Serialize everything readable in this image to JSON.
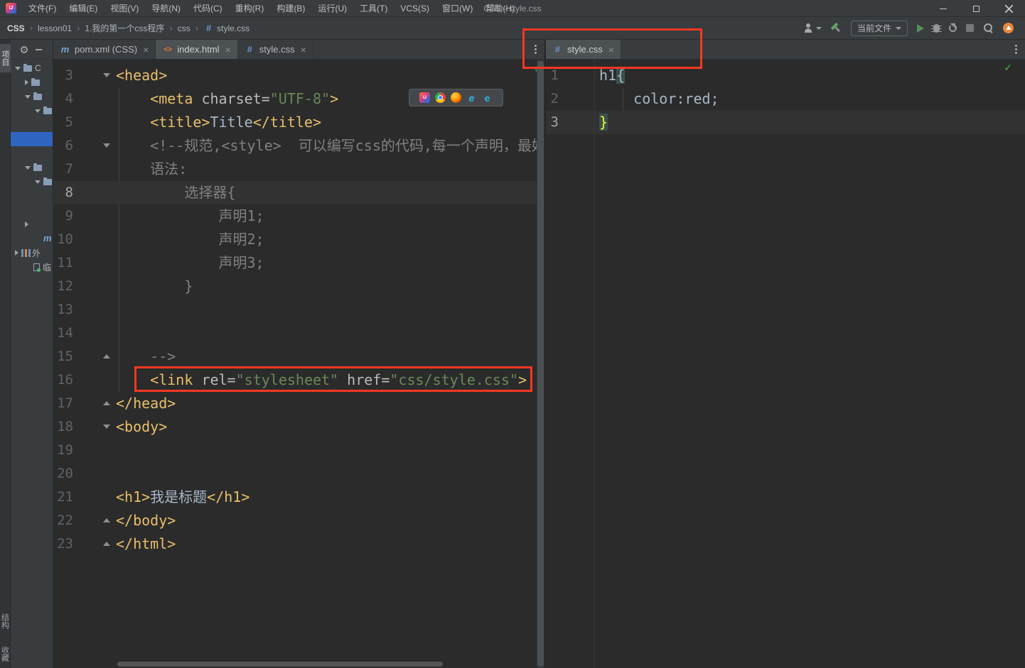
{
  "window": {
    "title": "CSS - style.css",
    "controls": [
      {
        "name": "minimize"
      },
      {
        "name": "maximize"
      },
      {
        "name": "close"
      }
    ]
  },
  "menubar": [
    "文件(F)",
    "编辑(E)",
    "视图(V)",
    "导航(N)",
    "代码(C)",
    "重构(R)",
    "构建(B)",
    "运行(U)",
    "工具(T)",
    "VCS(S)",
    "窗口(W)",
    "帮助(H)"
  ],
  "toolbar": {
    "breadcrumbs": [
      "CSS",
      "lesson01",
      "1.我的第一个css程序",
      "css",
      "style.css"
    ],
    "right": {
      "run_config": "当前文件"
    }
  },
  "stripe": {
    "top": [
      "项目"
    ],
    "bottom": [
      "结构",
      "收藏"
    ]
  },
  "project_tree": {
    "rows": [
      {
        "indent": 0,
        "chevron": "down",
        "icon": "folder",
        "label": "C",
        "selected": false
      },
      {
        "indent": 1,
        "chevron": "right",
        "icon": "folder",
        "label": "",
        "selected": false
      },
      {
        "indent": 1,
        "chevron": "down",
        "icon": "folder",
        "label": "",
        "selected": false
      },
      {
        "indent": 2,
        "chevron": "down",
        "icon": "folder",
        "label": "",
        "selected": false
      },
      {
        "indent": 3,
        "chevron": "none",
        "icon": "none",
        "label": "",
        "selected": false
      },
      {
        "indent": 3,
        "chevron": "none",
        "icon": "none",
        "label": "",
        "selected": true
      },
      {
        "indent": 3,
        "chevron": "none",
        "icon": "none",
        "label": "",
        "selected": false
      },
      {
        "indent": 1,
        "chevron": "down",
        "icon": "folder",
        "label": "",
        "selected": false
      },
      {
        "indent": 2,
        "chevron": "down",
        "icon": "folder",
        "label": "",
        "selected": false
      },
      {
        "indent": 3,
        "chevron": "none",
        "icon": "none",
        "label": "",
        "selected": false
      },
      {
        "indent": 3,
        "chevron": "none",
        "icon": "none",
        "label": "",
        "selected": false
      },
      {
        "indent": 1,
        "chevron": "right",
        "icon": "none",
        "label": "",
        "selected": false
      },
      {
        "indent": 2,
        "chevron": "none",
        "icon": "maven",
        "label": "",
        "selected": false
      },
      {
        "indent": 0,
        "chevron": "right",
        "icon": "libraries",
        "label": "外",
        "selected": false
      },
      {
        "indent": 1,
        "chevron": "none",
        "icon": "scratches",
        "label": "临",
        "selected": false
      }
    ]
  },
  "editors": {
    "left": {
      "tabs": [
        {
          "label": "pom.xml (CSS)",
          "icon": "maven",
          "selected": false,
          "close": "×"
        },
        {
          "label": "index.html",
          "icon": "html",
          "selected": true,
          "close": "×"
        },
        {
          "label": "style.css",
          "icon": "css",
          "selected": false,
          "close": "×"
        }
      ],
      "status_check": "✓",
      "lines": [
        {
          "n": 3,
          "fold": "down",
          "t": [
            [
              "g",
              "<head>"
            ]
          ]
        },
        {
          "n": 4,
          "t": [
            [
              "pl",
              "    "
            ],
            [
              "g",
              "<meta"
            ],
            [
              "pl",
              " "
            ],
            [
              "a",
              "charset="
            ],
            [
              "s",
              "\"UTF-8\""
            ],
            [
              "g",
              ">"
            ]
          ]
        },
        {
          "n": 5,
          "t": [
            [
              "pl",
              "    "
            ],
            [
              "g",
              "<title>"
            ],
            [
              "pl",
              "Title"
            ],
            [
              "g",
              "</title>"
            ]
          ]
        },
        {
          "n": 6,
          "fold": "down",
          "t": [
            [
              "c",
              "    <!--规范,<style>  可以编写css的代码,每一个声明，最好使"
            ]
          ]
        },
        {
          "n": 7,
          "t": [
            [
              "c",
              "    语法:"
            ]
          ]
        },
        {
          "n": 8,
          "current": true,
          "t": [
            [
              "c",
              "        选择器{"
            ]
          ]
        },
        {
          "n": 9,
          "t": [
            [
              "c",
              "            声明1;"
            ]
          ]
        },
        {
          "n": 10,
          "t": [
            [
              "c",
              "            声明2;"
            ]
          ]
        },
        {
          "n": 11,
          "t": [
            [
              "c",
              "            声明3;"
            ]
          ]
        },
        {
          "n": 12,
          "t": [
            [
              "c",
              "        }"
            ]
          ]
        },
        {
          "n": 13,
          "t": []
        },
        {
          "n": 14,
          "t": []
        },
        {
          "n": 15,
          "fold": "up",
          "t": [
            [
              "c",
              "    -->"
            ]
          ]
        },
        {
          "n": 16,
          "t": [
            [
              "pl",
              "    "
            ],
            [
              "g",
              "<link"
            ],
            [
              "pl",
              " "
            ],
            [
              "a",
              "rel="
            ],
            [
              "s",
              "\"stylesheet\""
            ],
            [
              "pl",
              " "
            ],
            [
              "a",
              "href="
            ],
            [
              "s",
              "\"css/style.css\""
            ],
            [
              "g",
              ">"
            ]
          ]
        },
        {
          "n": 17,
          "fold": "up",
          "t": [
            [
              "g",
              "</head>"
            ]
          ]
        },
        {
          "n": 18,
          "fold": "down",
          "t": [
            [
              "g",
              "<body>"
            ]
          ]
        },
        {
          "n": 19,
          "t": []
        },
        {
          "n": 20,
          "t": []
        },
        {
          "n": 21,
          "t": [
            [
              "g",
              "<h1>"
            ],
            [
              "pl",
              "我是标题"
            ],
            [
              "g",
              "</h1>"
            ]
          ]
        },
        {
          "n": 22,
          "fold": "up",
          "t": [
            [
              "g",
              "</body>"
            ]
          ]
        },
        {
          "n": 23,
          "fold": "up",
          "t": [
            [
              "g",
              "</html>"
            ]
          ]
        }
      ]
    },
    "right": {
      "tabs": [
        {
          "label": "style.css",
          "icon": "css",
          "selected": true,
          "close": "×"
        }
      ],
      "status_check": "✓",
      "lines": [
        {
          "n": 1,
          "t": [
            [
              "pl",
              "h1"
            ],
            [
              "bh",
              "{"
            ]
          ]
        },
        {
          "n": 2,
          "t": [
            [
              "pl",
              "    color:red;"
            ]
          ]
        },
        {
          "n": 3,
          "current": true,
          "t": [
            [
              "by",
              "}"
            ]
          ]
        }
      ]
    }
  },
  "browser_bar": {
    "icons": [
      "idea",
      "chrome",
      "firefox",
      "ie",
      "edge"
    ]
  },
  "colors": {
    "annotation_highlight": "#f93822",
    "tag": "#e8bf6a",
    "string": "#6a8759",
    "comment": "#808080",
    "selection_blue": "#2e65c0",
    "editor_background": "#2b2b2b"
  }
}
